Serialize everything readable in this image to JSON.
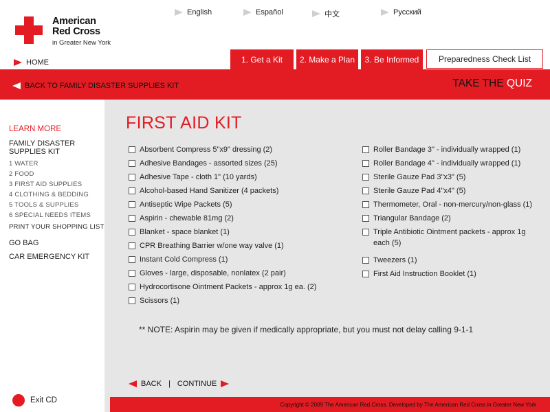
{
  "brand": {
    "line1": "American",
    "line2": "Red Cross",
    "line3": "in Greater New York"
  },
  "languages": [
    "English",
    "Español",
    "中文",
    "Русский"
  ],
  "home_label": "HOME",
  "tabs": [
    "1. Get a Kit",
    "2. Make a Plan",
    "3. Be Informed"
  ],
  "check_list_label": "Preparedness Check List",
  "back_link": "BACK TO FAMILY DISASTER SUPPLIES KIT",
  "quiz": {
    "part1": "TAKE THE ",
    "part2": "QUIZ"
  },
  "sidebar": {
    "learn_more": "LEARN MORE",
    "family_kit_line1": "FAMILY DISASTER",
    "family_kit_line2": "SUPPLIES KIT",
    "subitems": [
      "1 WATER",
      "2 FOOD",
      "3 FIRST AID SUPPLIES",
      "4 CLOTHING & BEDDING",
      "5 TOOLS & SUPPLIES",
      "6 SPECIAL NEEDS ITEMS"
    ],
    "print_list": "PRINT YOUR SHOPPING LIST",
    "go_bag": "GO BAG",
    "car_kit": "CAR EMERGENCY KIT",
    "exit": "Exit CD"
  },
  "page_title": "FIRST AID KIT",
  "left_items": [
    "Absorbent Compress 5\"x9\" dressing (2)",
    "Adhesive Bandages - assorted sizes (25)",
    "Adhesive Tape - cloth 1\" (10 yards)",
    "Alcohol-based Hand Sanitizer (4 packets)",
    "Antiseptic Wipe Packets (5)",
    "Aspirin - chewable 81mg (2)",
    "Blanket - space blanket (1)",
    "CPR Breathing Barrier w/one way valve (1)",
    "Instant Cold Compress (1)",
    "Gloves - large, disposable, nonlatex (2 pair)",
    "Hydrocortisone Ointment Packets - approx 1g ea. (2)",
    "Scissors (1)"
  ],
  "right_items": [
    "Roller Bandage 3\" - individually wrapped (1)",
    "Roller Bandage 4\" - individually wrapped (1)",
    "Sterile Gauze Pad 3\"x3\" (5)",
    "Sterile Gauze Pad 4\"x4\" (5)",
    "Thermometer, Oral - non-mercury/non-glass (1)",
    "Triangular Bandage (2)",
    "Triple Antibiotic Ointment packets - approx 1g each (5)",
    "Tweezers (1)",
    "First Aid Instruction Booklet (1)"
  ],
  "note": "** NOTE: Aspirin may be given if medically appropriate, but you must not delay calling 9-1-1",
  "nav": {
    "back": "BACK",
    "separator": "|",
    "continue": "CONTINUE"
  },
  "footer": "Copyright © 2009 The American Red Cross. Developed by The American Red Cross in Greater New York",
  "colors": {
    "brand_red": "#e31b23",
    "main_bg": "#e6e6e6",
    "arrow_grey": "#cfcfcf"
  }
}
